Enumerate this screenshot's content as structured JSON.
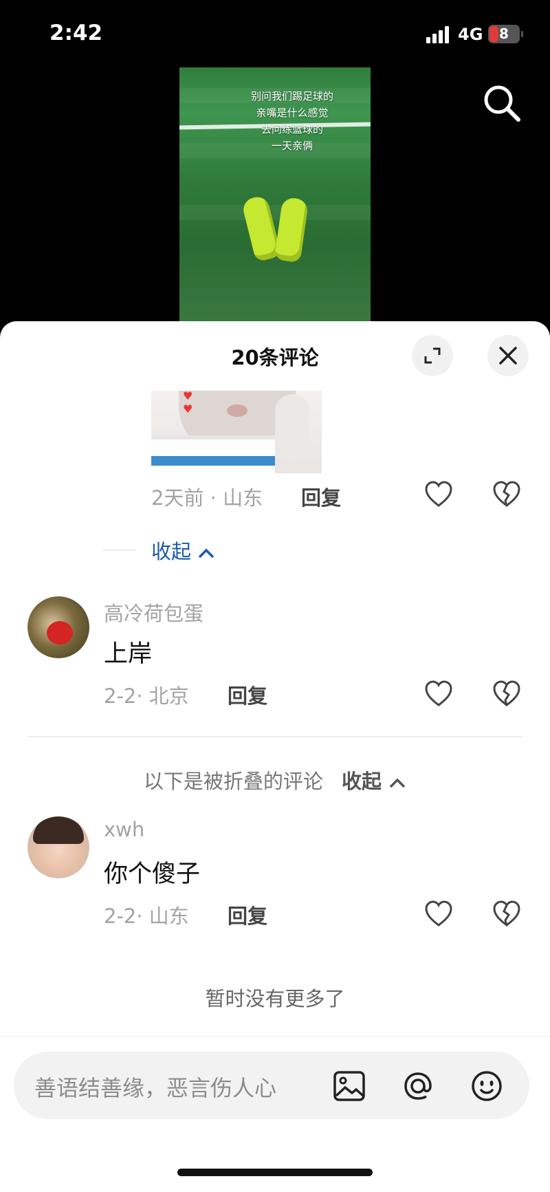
{
  "status_bar": {
    "time": "2:42",
    "network": "4G",
    "battery": "8"
  },
  "video": {
    "caption_lines": [
      "别问我们踢足球的",
      "亲嘴是什么感觉",
      "去问练篮球的",
      "一天亲俩"
    ]
  },
  "header": {
    "title": "20条评论"
  },
  "reply_item": {
    "meta": "2天前 · 山东",
    "reply_label": "回复"
  },
  "collapse_label": "收起",
  "comments": [
    {
      "username": "高冷荷包蛋",
      "text": "上岸",
      "meta": "2-2· 北京",
      "reply_label": "回复"
    },
    {
      "username": "xwh",
      "text": "你个傻子",
      "meta": "2-2· 山东",
      "reply_label": "回复"
    }
  ],
  "folded": {
    "text": "以下是被折叠的评论",
    "toggle": "收起"
  },
  "no_more": "暂时没有更多了",
  "input": {
    "placeholder": "善语结善缘，恶言伤人心"
  },
  "icons": {
    "search": "search-icon",
    "expand": "expand-icon",
    "close": "close-icon",
    "like": "heart-icon",
    "dislike": "broken-heart-icon",
    "image": "image-icon",
    "mention": "at-icon",
    "emoji": "emoji-icon"
  },
  "colors": {
    "accent": "#1a5aa8",
    "battery_low": "#e03a3a"
  }
}
